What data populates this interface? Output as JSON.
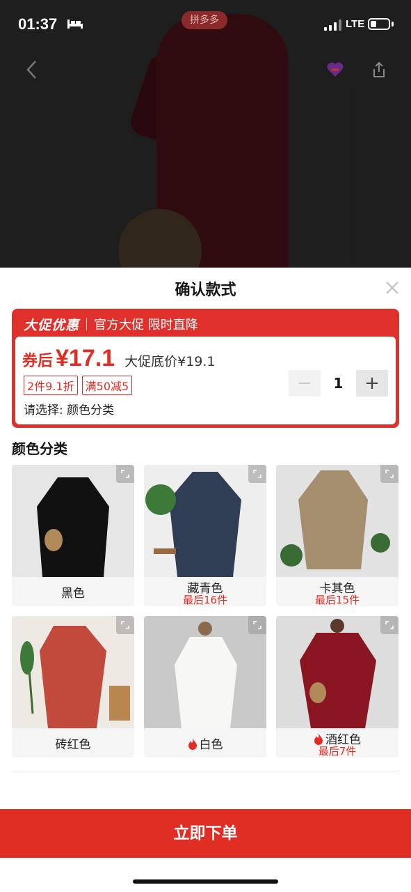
{
  "status_bar": {
    "time": "01:37",
    "network": "LTE"
  },
  "header": {
    "brand_badge": "拼多多"
  },
  "sheet": {
    "title": "确认款式",
    "promo": {
      "brand": "大促优惠",
      "slogan": "官方大促 限时直降",
      "price_label": "券后",
      "price_value": "¥17.1",
      "price_original": "大促底价¥19.1",
      "tags": [
        "2件9.1折",
        "满50减5"
      ],
      "select_hint": "请选择: 颜色分类",
      "quantity": "1",
      "minus": "−",
      "plus": "+"
    },
    "section_title": "颜色分类",
    "options": [
      {
        "name": "黑色",
        "stock": "",
        "hot": false,
        "color": "#111111",
        "bg": "#e6e6e6"
      },
      {
        "name": "藏青色",
        "stock": "最后16件",
        "hot": false,
        "color": "#2f3e55",
        "bg": "#eeeeee"
      },
      {
        "name": "卡其色",
        "stock": "最后15件",
        "hot": false,
        "color": "#a58e6d",
        "bg": "#e2e2e2"
      },
      {
        "name": "砖红色",
        "stock": "",
        "hot": false,
        "color": "#c24a3c",
        "bg": "#efe9e4"
      },
      {
        "name": "白色",
        "stock": "",
        "hot": true,
        "color": "#f7f7f5",
        "bg": "#c9c9c9"
      },
      {
        "name": "酒红色",
        "stock": "最后7件",
        "hot": true,
        "color": "#8a1621",
        "bg": "#dddddd"
      }
    ],
    "order_button": "立即下单"
  },
  "colors": {
    "accent": "#e02e24",
    "promo_red": "#e0302b"
  }
}
